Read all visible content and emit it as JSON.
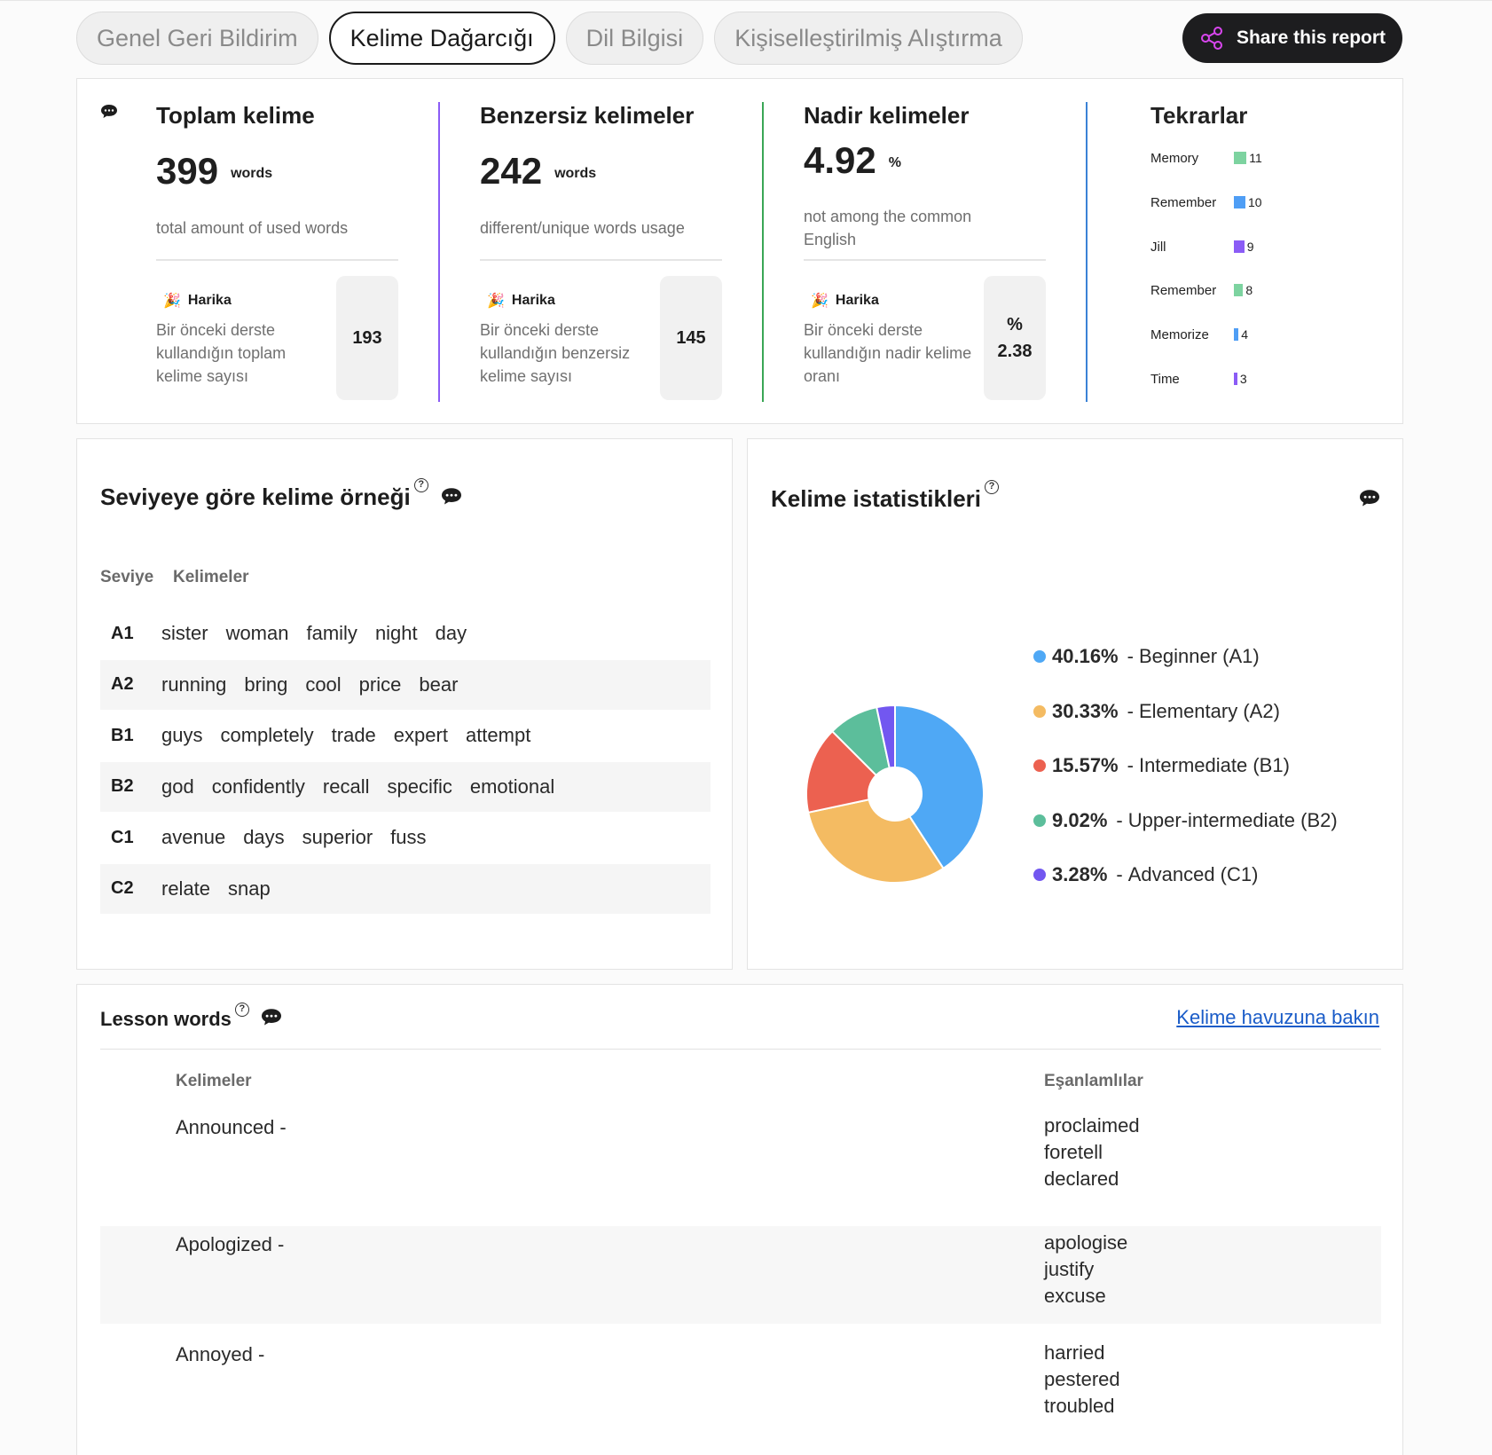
{
  "tabs": [
    {
      "label": "Genel Geri Bildirim",
      "active": false
    },
    {
      "label": "Kelime Dağarcığı",
      "active": true
    },
    {
      "label": "Dil Bilgisi",
      "active": false
    },
    {
      "label": "Kişiselleştirilmiş Alıştırma",
      "active": false
    }
  ],
  "share_label": "Share this report",
  "stats": {
    "total": {
      "title": "Toplam kelime",
      "value": "399",
      "unit": "words",
      "desc": "total amount of used words",
      "praise": "Harika",
      "praise_desc": "Bir önceki derste kullandığın toplam kelime sayısı",
      "prev_value": "193"
    },
    "unique": {
      "title": "Benzersiz kelimeler",
      "value": "242",
      "unit": "words",
      "desc": "different/unique words usage",
      "praise": "Harika",
      "praise_desc": "Bir önceki derste kullandığın benzersiz kelime sayısı",
      "prev_value": "145"
    },
    "rare": {
      "title": "Nadir kelimeler",
      "value": "4.92",
      "unit": "%",
      "desc": "not among the common English",
      "praise": "Harika",
      "praise_desc": "Bir önceki derste kullandığın nadir kelime oranı",
      "prev_prefix": "%",
      "prev_value": "2.38"
    },
    "divider_colors": [
      "#8b5cf6",
      "#3aa655",
      "#3b82d6"
    ]
  },
  "repetitions": {
    "title": "Tekrarlar",
    "items": [
      {
        "word": "Memory",
        "count": 11,
        "color": "#7dd3a0"
      },
      {
        "word": "Remember",
        "count": 10,
        "color": "#4f9ef5"
      },
      {
        "word": "Jill",
        "count": 9,
        "color": "#8b5cf6"
      },
      {
        "word": "Remember",
        "count": 8,
        "color": "#7dd3a0"
      },
      {
        "word": "Memorize",
        "count": 4,
        "color": "#4f9ef5"
      },
      {
        "word": "Time",
        "count": 3,
        "color": "#8b5cf6"
      }
    ]
  },
  "levels": {
    "title": "Seviyeye göre kelime örneği",
    "help": "?",
    "col_level": "Seviye",
    "col_words": "Kelimeler",
    "rows": [
      {
        "code": "A1",
        "words": [
          "sister",
          "woman",
          "family",
          "night",
          "day"
        ]
      },
      {
        "code": "A2",
        "words": [
          "running",
          "bring",
          "cool",
          "price",
          "bear"
        ]
      },
      {
        "code": "B1",
        "words": [
          "guys",
          "completely",
          "trade",
          "expert",
          "attempt"
        ]
      },
      {
        "code": "B2",
        "words": [
          "god",
          "confidently",
          "recall",
          "specific",
          "emotional"
        ]
      },
      {
        "code": "C1",
        "words": [
          "avenue",
          "days",
          "superior",
          "fuss"
        ]
      },
      {
        "code": "C2",
        "words": [
          "relate",
          "snap"
        ]
      }
    ]
  },
  "word_stats": {
    "title": "Kelime istatistikleri",
    "help": "?"
  },
  "chart_data": {
    "type": "pie",
    "title": "",
    "donut": true,
    "series": [
      {
        "name": "Beginner (A1)",
        "value": 40.16,
        "label": "40.16%",
        "color": "#4fa8f5"
      },
      {
        "name": "Elementary (A2)",
        "value": 30.33,
        "label": "30.33%",
        "color": "#f4bb62"
      },
      {
        "name": "Intermediate (B1)",
        "value": 15.57,
        "label": "15.57%",
        "color": "#ec6150"
      },
      {
        "name": "Upper-intermediate (B2)",
        "value": 9.02,
        "label": "9.02%",
        "color": "#5cbe9b"
      },
      {
        "name": "Advanced (C1)",
        "value": 3.28,
        "label": "3.28%",
        "color": "#7257f0"
      }
    ]
  },
  "lesson": {
    "title": "Lesson words",
    "help": "?",
    "link": "Kelime havuzuna bakın",
    "col_words": "Kelimeler",
    "col_synonyms": "Eşanlamlılar",
    "rows": [
      {
        "word": "Announced -",
        "synonyms": [
          "proclaimed",
          "foretell",
          "declared"
        ]
      },
      {
        "word": "Apologized -",
        "synonyms": [
          "apologise",
          "justify",
          "excuse"
        ]
      },
      {
        "word": "Annoyed -",
        "synonyms": [
          "harried",
          "pestered",
          "troubled"
        ]
      }
    ]
  }
}
